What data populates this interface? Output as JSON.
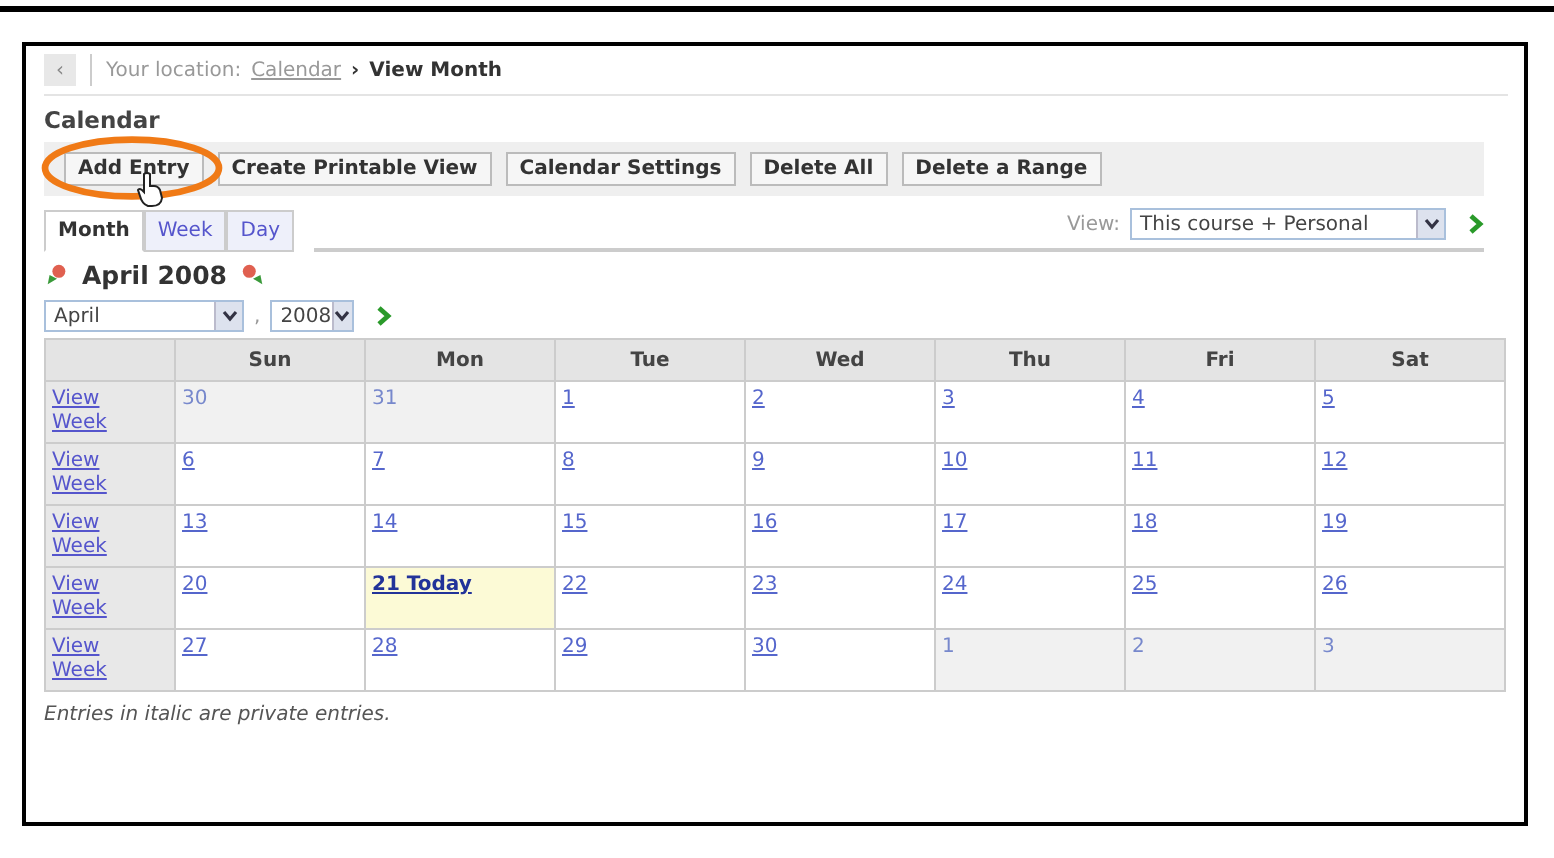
{
  "breadcrumb": {
    "back": "‹",
    "prefix": "Your location:",
    "link": "Calendar",
    "separator": "›",
    "current": "View Month"
  },
  "title": "Calendar",
  "toolbar": [
    {
      "label": "Add Entry",
      "highlighted": true
    },
    {
      "label": "Create Printable View",
      "highlighted": false
    },
    {
      "label": "Calendar Settings",
      "highlighted": false
    },
    {
      "label": "Delete All",
      "highlighted": false
    },
    {
      "label": "Delete a Range",
      "highlighted": false
    }
  ],
  "tabs": [
    {
      "label": "Month",
      "selected": true
    },
    {
      "label": "Week",
      "selected": false
    },
    {
      "label": "Day",
      "selected": false
    }
  ],
  "view_filter": {
    "label": "View:",
    "value": "This course + Personal"
  },
  "month_heading": "April 2008",
  "month_select": {
    "value": "April"
  },
  "year_select": {
    "value": "2008"
  },
  "comma": ",",
  "calendar": {
    "columns": [
      "",
      "Sun",
      "Mon",
      "Tue",
      "Wed",
      "Thu",
      "Fri",
      "Sat"
    ],
    "rows": [
      {
        "link": "View Week",
        "days": [
          {
            "label": "30",
            "kind": "outside"
          },
          {
            "label": "31",
            "kind": "outside"
          },
          {
            "label": "1",
            "kind": "day"
          },
          {
            "label": "2",
            "kind": "day"
          },
          {
            "label": "3",
            "kind": "day"
          },
          {
            "label": "4",
            "kind": "day"
          },
          {
            "label": "5",
            "kind": "day"
          }
        ]
      },
      {
        "link": "View Week",
        "days": [
          {
            "label": "6",
            "kind": "day"
          },
          {
            "label": "7",
            "kind": "day"
          },
          {
            "label": "8",
            "kind": "day"
          },
          {
            "label": "9",
            "kind": "day"
          },
          {
            "label": "10",
            "kind": "day"
          },
          {
            "label": "11",
            "kind": "day"
          },
          {
            "label": "12",
            "kind": "day"
          }
        ]
      },
      {
        "link": "View Week",
        "days": [
          {
            "label": "13",
            "kind": "day"
          },
          {
            "label": "14",
            "kind": "day"
          },
          {
            "label": "15",
            "kind": "day"
          },
          {
            "label": "16",
            "kind": "day"
          },
          {
            "label": "17",
            "kind": "day"
          },
          {
            "label": "18",
            "kind": "day"
          },
          {
            "label": "19",
            "kind": "day"
          }
        ]
      },
      {
        "link": "View Week",
        "days": [
          {
            "label": "20",
            "kind": "day"
          },
          {
            "label": "21 Today",
            "kind": "today"
          },
          {
            "label": "22",
            "kind": "day"
          },
          {
            "label": "23",
            "kind": "day"
          },
          {
            "label": "24",
            "kind": "day"
          },
          {
            "label": "25",
            "kind": "day"
          },
          {
            "label": "26",
            "kind": "day"
          }
        ]
      },
      {
        "link": "View Week",
        "days": [
          {
            "label": "27",
            "kind": "day"
          },
          {
            "label": "28",
            "kind": "day"
          },
          {
            "label": "29",
            "kind": "day"
          },
          {
            "label": "30",
            "kind": "day"
          },
          {
            "label": "1",
            "kind": "outside"
          },
          {
            "label": "2",
            "kind": "outside"
          },
          {
            "label": "3",
            "kind": "outside"
          }
        ]
      }
    ]
  },
  "footnote": "Entries in italic are private entries."
}
